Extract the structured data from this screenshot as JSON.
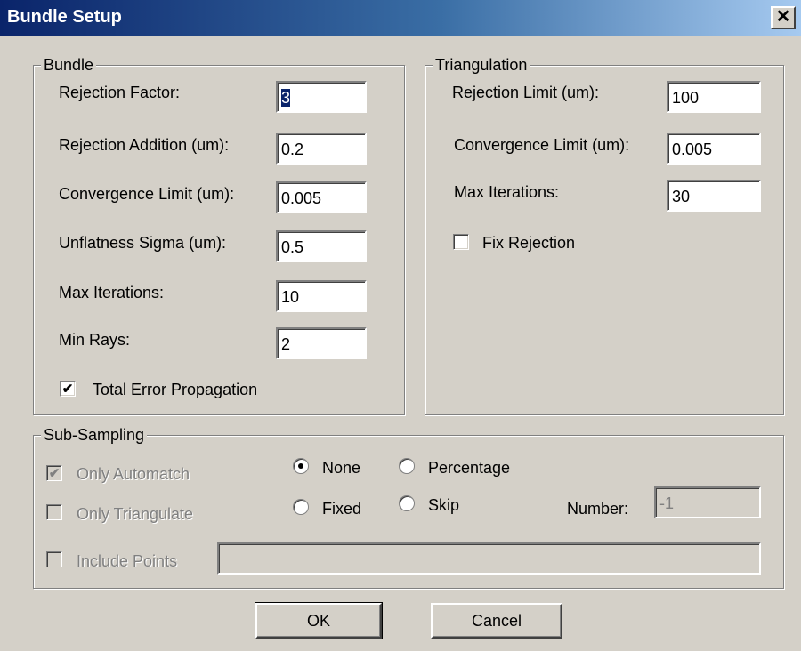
{
  "window": {
    "title": "Bundle Setup",
    "close_glyph": "✕",
    "close_icon_name": "close-icon"
  },
  "bundle": {
    "legend": "Bundle",
    "rejection_factor_label": "Rejection Factor:",
    "rejection_factor_value": "3",
    "rejection_addition_label": "Rejection Addition (um):",
    "rejection_addition_value": "0.2",
    "convergence_limit_label": "Convergence Limit (um):",
    "convergence_limit_value": "0.005",
    "unflatness_sigma_label": "Unflatness Sigma (um):",
    "unflatness_sigma_value": "0.5",
    "max_iterations_label": "Max Iterations:",
    "max_iterations_value": "10",
    "min_rays_label": "Min Rays:",
    "min_rays_value": "2",
    "total_error_label": "Total Error Propagation",
    "total_error_checked": true
  },
  "triangulation": {
    "legend": "Triangulation",
    "rejection_limit_label": "Rejection Limit (um):",
    "rejection_limit_value": "100",
    "convergence_limit_label": "Convergence Limit (um):",
    "convergence_limit_value": "0.005",
    "max_iterations_label": "Max Iterations:",
    "max_iterations_value": "30",
    "fix_rejection_label": "Fix Rejection",
    "fix_rejection_checked": false
  },
  "subsampling": {
    "legend": "Sub-Sampling",
    "only_automatch_label": "Only Automatch",
    "only_automatch_checked": true,
    "only_triangulate_label": "Only Triangulate",
    "only_triangulate_checked": false,
    "include_points_label": "Include Points",
    "include_points_checked": false,
    "include_points_value": "",
    "radio_none_label": "None",
    "radio_percentage_label": "Percentage",
    "radio_fixed_label": "Fixed",
    "radio_skip_label": "Skip",
    "selected_mode": "None",
    "number_label": "Number:",
    "number_value": "-1"
  },
  "buttons": {
    "ok_label": "OK",
    "cancel_label": "Cancel"
  },
  "check_glyph": "✔"
}
